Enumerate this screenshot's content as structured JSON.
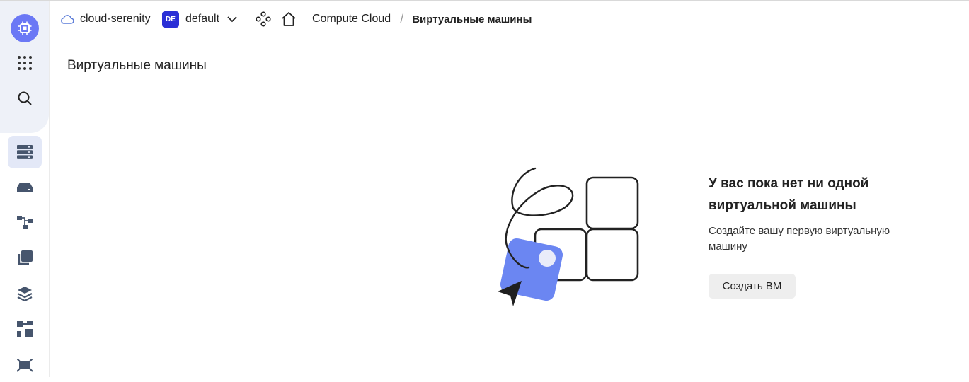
{
  "header": {
    "cloud_name": "cloud-serenity",
    "org_badge": "DE",
    "folder_name": "default",
    "breadcrumb": {
      "service": "Compute Cloud",
      "separator": "/",
      "current": "Виртуальные машины"
    }
  },
  "sidebar": {
    "icons": [
      "app-logo-icon",
      "all-services-icon",
      "search-icon",
      "virtual-machines-icon",
      "disks-icon",
      "instance-groups-icon",
      "snapshots-icon",
      "images-icon",
      "placement-groups-icon",
      "more-icon"
    ],
    "active_item": "virtual-machines"
  },
  "main": {
    "title": "Виртуальные машины",
    "empty_state": {
      "title": "У вас пока нет ни одной виртуальной машины",
      "description": "Создайте вашу первую виртуальную машину",
      "button": "Создать ВМ"
    }
  },
  "colors": {
    "accent": "#6b78f5",
    "badge": "#2a2fd6",
    "rail_bg": "#eef1f8",
    "active_item_bg": "#e3e8f7"
  }
}
